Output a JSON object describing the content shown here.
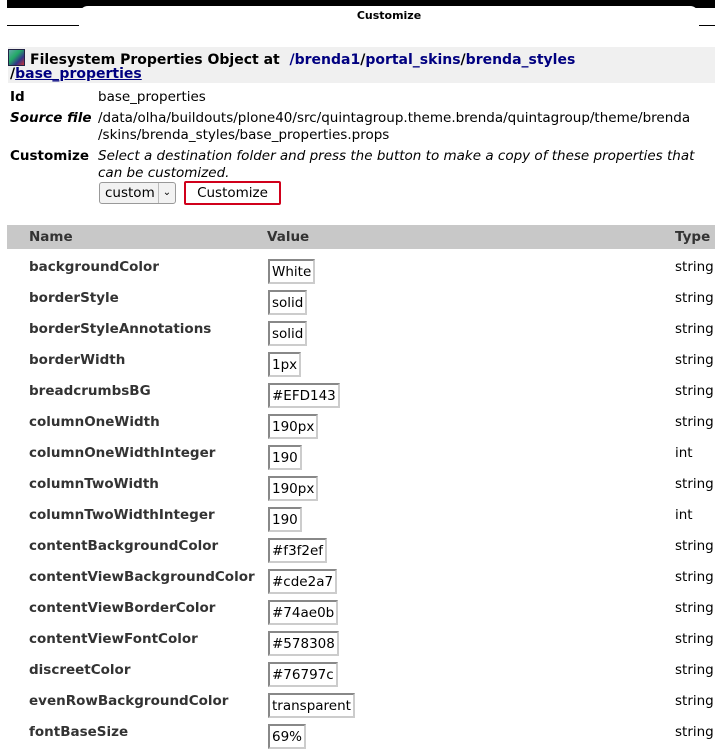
{
  "tab_title": "Customize",
  "header": {
    "prefix": "Filesystem Properties Object at",
    "path_parts": [
      "/brenda1",
      "/",
      "portal_skins",
      "/",
      "brenda_styles"
    ],
    "slash": "/",
    "object_name": "base_properties"
  },
  "details": {
    "id_label": "Id",
    "id_value": "base_properties",
    "source_label": "Source file",
    "source_line1": "/data/olha/buildouts/plone40/src/quintagroup.theme.brenda/quintagroup/theme/brenda",
    "source_line2": "/skins/brenda_styles/base_properties.props",
    "customize_label": "Customize",
    "customize_text1": "Select a destination folder and press the button to make a copy of these properties that",
    "customize_text2": "can be customized."
  },
  "controls": {
    "folder_select_value": "custom",
    "customize_button": "Customize"
  },
  "table": {
    "headers": [
      "Name",
      "Value",
      "Type"
    ],
    "rows": [
      {
        "name": "backgroundColor",
        "value": "White",
        "type": "string"
      },
      {
        "name": "borderStyle",
        "value": "solid",
        "type": "string"
      },
      {
        "name": "borderStyleAnnotations",
        "value": "solid",
        "type": "string"
      },
      {
        "name": "borderWidth",
        "value": "1px",
        "type": "string"
      },
      {
        "name": "breadcrumbsBG",
        "value": "#EFD143",
        "type": "string"
      },
      {
        "name": "columnOneWidth",
        "value": "190px",
        "type": "string"
      },
      {
        "name": "columnOneWidthInteger",
        "value": "190",
        "type": "int"
      },
      {
        "name": "columnTwoWidth",
        "value": "190px",
        "type": "string"
      },
      {
        "name": "columnTwoWidthInteger",
        "value": "190",
        "type": "int"
      },
      {
        "name": "contentBackgroundColor",
        "value": "#f3f2ef",
        "type": "string"
      },
      {
        "name": "contentViewBackgroundColor",
        "value": "#cde2a7",
        "type": "string"
      },
      {
        "name": "contentViewBorderColor",
        "value": "#74ae0b",
        "type": "string"
      },
      {
        "name": "contentViewFontColor",
        "value": "#578308",
        "type": "string"
      },
      {
        "name": "discreetColor",
        "value": "#76797c",
        "type": "string"
      },
      {
        "name": "evenRowBackgroundColor",
        "value": "transparent",
        "type": "string"
      },
      {
        "name": "fontBaseSize",
        "value": "69%",
        "type": "string"
      }
    ]
  }
}
